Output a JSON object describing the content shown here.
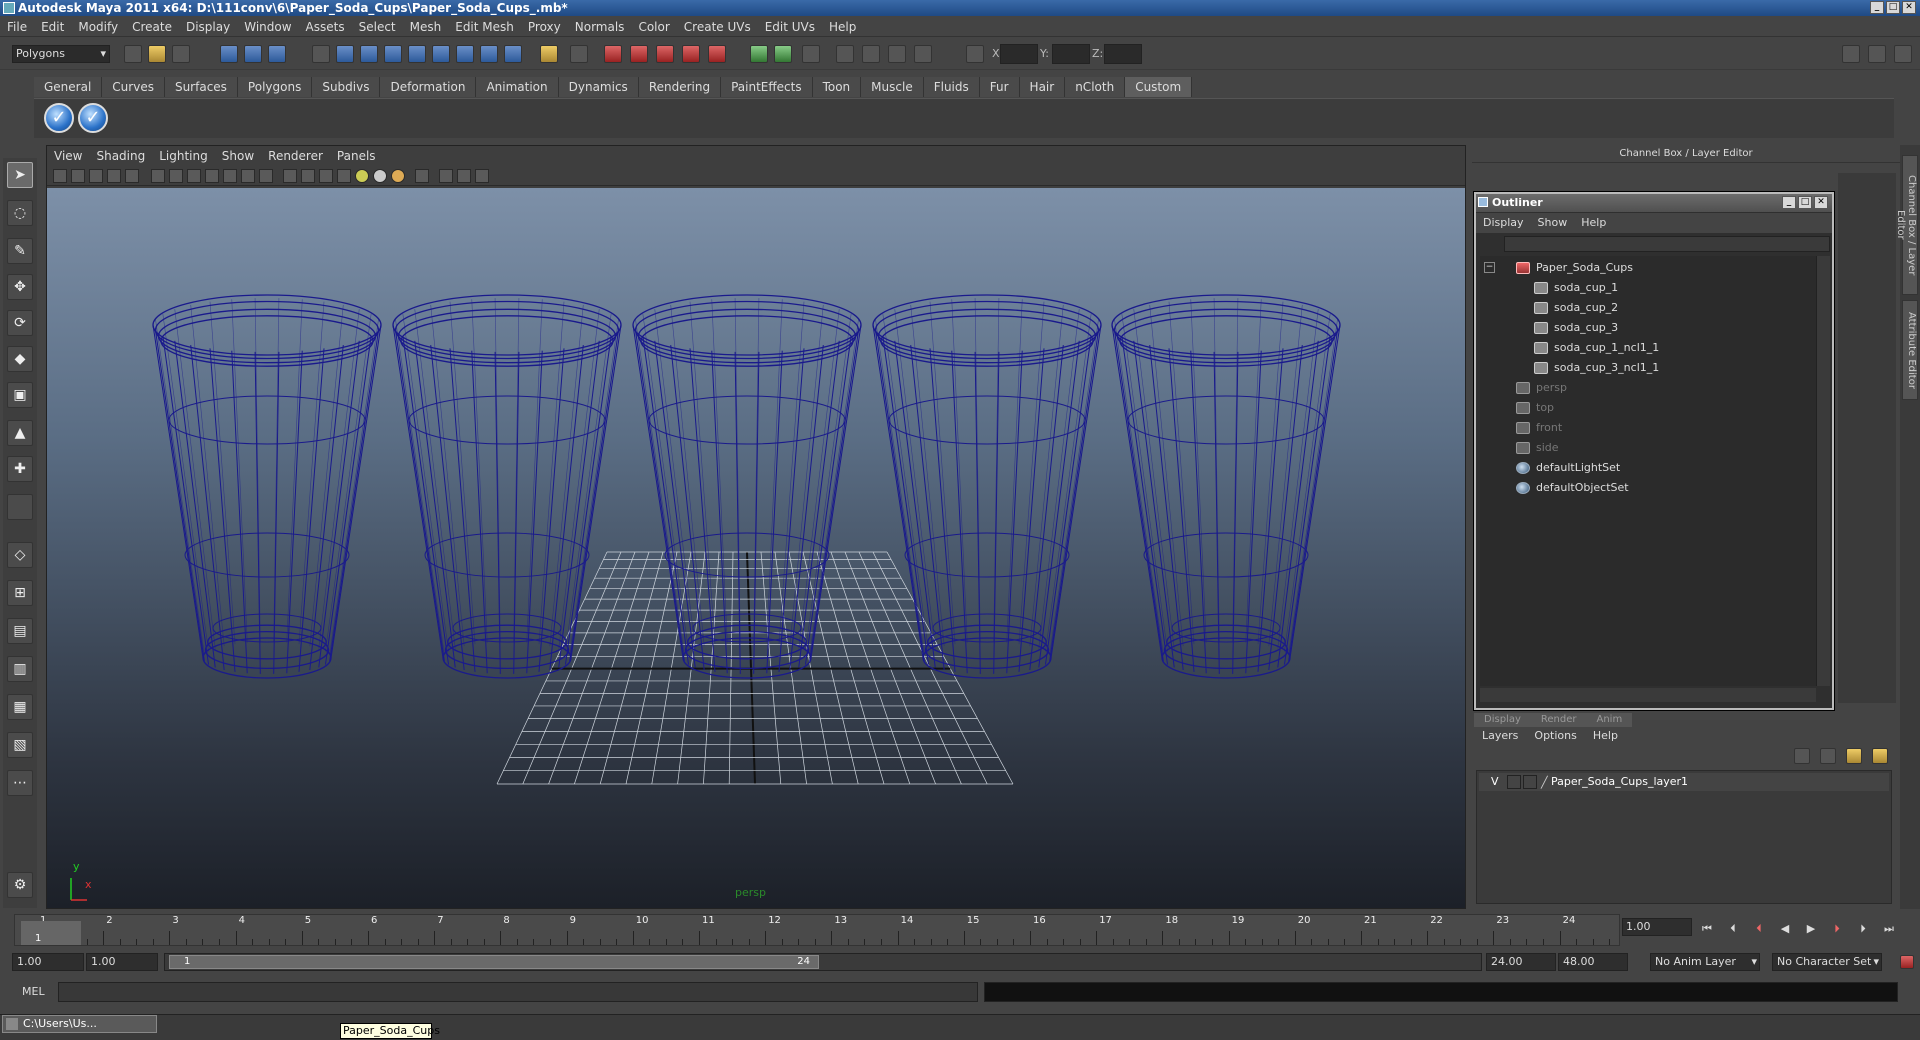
{
  "window": {
    "title": "Autodesk Maya 2011 x64: D:\\111conv\\6\\Paper_Soda_Cups\\Paper_Soda_Cups_.mb*"
  },
  "menubar": [
    "File",
    "Edit",
    "Modify",
    "Create",
    "Display",
    "Window",
    "Assets",
    "Select",
    "Mesh",
    "Edit Mesh",
    "Proxy",
    "Normals",
    "Color",
    "Create UVs",
    "Edit UVs",
    "Help"
  ],
  "statusline": {
    "mode": "Polygons",
    "x_label": "X:",
    "y_label": "Y:",
    "z_label": "Z:"
  },
  "shelf": {
    "tabs": [
      "General",
      "Curves",
      "Surfaces",
      "Polygons",
      "Subdivs",
      "Deformation",
      "Animation",
      "Dynamics",
      "Rendering",
      "PaintEffects",
      "Toon",
      "Muscle",
      "Fluids",
      "Fur",
      "Hair",
      "nCloth",
      "Custom"
    ],
    "active_tab": "Custom",
    "buttons": [
      "✓",
      "✓"
    ]
  },
  "viewport": {
    "menu": [
      "View",
      "Shading",
      "Lighting",
      "Show",
      "Renderer",
      "Panels"
    ],
    "camera": "persp",
    "axis_x": "x",
    "axis_y": "y",
    "cups": 5
  },
  "right_panel": {
    "header": "Channel Box / Layer Editor",
    "side_tabs": [
      "Channel Box / Layer Editor",
      "Attribute Editor"
    ]
  },
  "outliner": {
    "title": "Outliner",
    "menu": [
      "Display",
      "Show",
      "Help"
    ],
    "items": [
      {
        "label": "Paper_Soda_Cups",
        "type": "group",
        "indent": 0,
        "dim": false
      },
      {
        "label": "soda_cup_1",
        "type": "transform",
        "indent": 1,
        "dim": false
      },
      {
        "label": "soda_cup_2",
        "type": "transform",
        "indent": 1,
        "dim": false
      },
      {
        "label": "soda_cup_3",
        "type": "transform",
        "indent": 1,
        "dim": false
      },
      {
        "label": "soda_cup_1_ncl1_1",
        "type": "transform",
        "indent": 1,
        "dim": false
      },
      {
        "label": "soda_cup_3_ncl1_1",
        "type": "transform",
        "indent": 1,
        "dim": false
      },
      {
        "label": "persp",
        "type": "camera",
        "indent": 0,
        "dim": true
      },
      {
        "label": "top",
        "type": "camera",
        "indent": 0,
        "dim": true
      },
      {
        "label": "front",
        "type": "camera",
        "indent": 0,
        "dim": true
      },
      {
        "label": "side",
        "type": "camera",
        "indent": 0,
        "dim": true
      },
      {
        "label": "defaultLightSet",
        "type": "set",
        "indent": 0,
        "dim": false
      },
      {
        "label": "defaultObjectSet",
        "type": "set",
        "indent": 0,
        "dim": false
      }
    ]
  },
  "layer_editor": {
    "tabs": [
      "Display",
      "Render",
      "Anim"
    ],
    "menu": [
      "Layers",
      "Options",
      "Help"
    ],
    "layer": {
      "visible": "V",
      "name": "Paper_Soda_Cups_layer1"
    }
  },
  "timeline": {
    "ticks": [
      "1",
      "2",
      "3",
      "4",
      "5",
      "6",
      "7",
      "8",
      "9",
      "10",
      "11",
      "12",
      "13",
      "14",
      "15",
      "16",
      "17",
      "18",
      "19",
      "20",
      "21",
      "22",
      "23",
      "24"
    ],
    "current_frame_marker": "1",
    "current_time": "1.00"
  },
  "range": {
    "start_time": "1.00",
    "playback_start": "1.00",
    "range_start_label": "1",
    "range_end_label": "24",
    "playback_end": "24.00",
    "end_time": "48.00",
    "anim_layer": "No Anim Layer",
    "character_set": "No Character Set"
  },
  "command_line": {
    "label": "MEL"
  },
  "taskbar": {
    "window_label": "C:\\Users\\Us...",
    "tooltip": "Paper_Soda_Cups"
  }
}
